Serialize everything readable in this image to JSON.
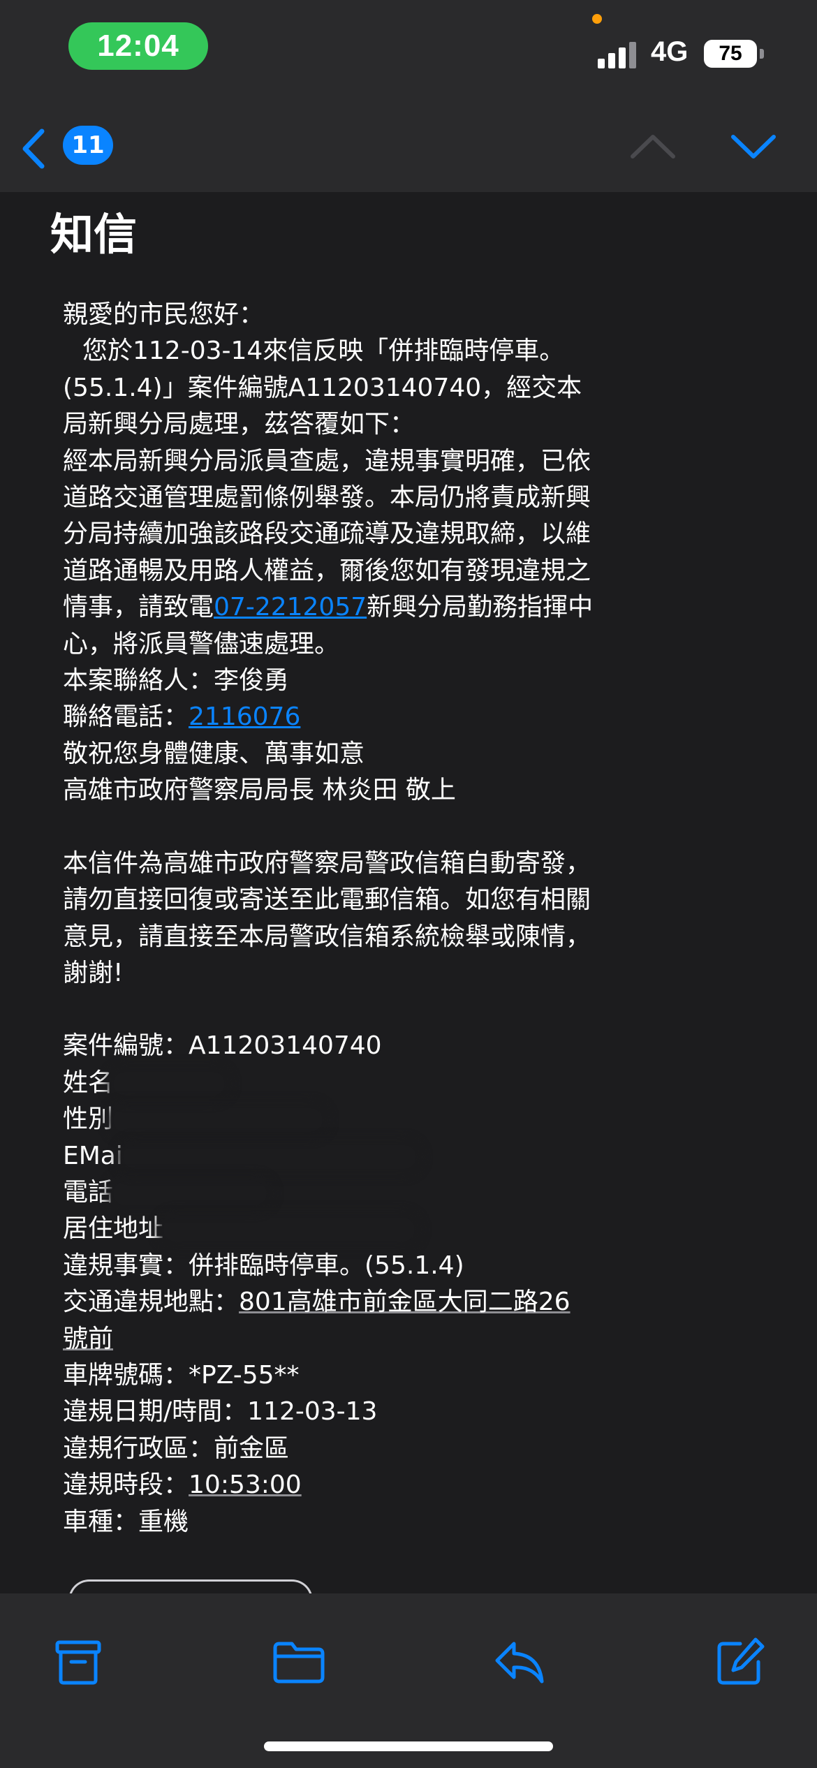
{
  "status_bar": {
    "time": "12:04",
    "network": "4G",
    "battery": "75",
    "colors": {
      "time_pill": "#34c759",
      "privacy_dot": "#ff9f0a"
    }
  },
  "nav": {
    "unread_count": "11",
    "back_icon": "chevron-left-icon",
    "prev_icon": "chevron-up-icon",
    "next_icon": "chevron-down-icon"
  },
  "email": {
    "subject": "知信",
    "greeting": "親愛的市民您好：",
    "p1_text": "您於112-03-14來信反映「併排臨時停車。(55.1.4)」案件編號A11203140740，經交本局新興分局處理，茲答覆如下：",
    "p2_text": "經本局新興分局派員查處，違規事實明確，已依道路交通管理處罰條例舉發。本局仍將責成新興分局持續加強該路段交通疏導及違規取締，以維道路通暢及用路人權益，爾後您如有發現違規之情事，請致電",
    "p2_phone": "07-2212057",
    "p2_suffix": "新興分局勤務指揮中心，將派員警儘速處理。",
    "contact_label": "本案聯絡人：",
    "contact_name": "李俊勇",
    "phone_label": "聯絡電話：",
    "phone_value": "2116076",
    "closing": "敬祝您身體健康、萬事如意",
    "signature": "高雄市政府警察局局長 林炎田 敬上",
    "notice": "本信件為高雄市政府警察局警政信箱自動寄發，請勿直接回復或寄送至此電郵信箱。如您有相關意見，請直接至本局警政信箱系統檢舉或陳情，謝謝!",
    "case_label": "案件編號：",
    "case_value": "A11203140740",
    "name_label": "姓名",
    "gender_label": "性別",
    "email_label": "EMai",
    "tel_label": "電話",
    "address_label": "居住地址",
    "violation_label": "違規事實：",
    "violation_value": "併排臨時停車。(55.1.4)",
    "location_label": "交通違規地點：",
    "location_value": "801高雄市前金區大同二路26號前",
    "plate_label": "車牌號碼：",
    "plate_value": "*PZ-55**",
    "date_label": "違規日期/時間：",
    "date_value": "112-03-13",
    "district_label": "違規行政區：",
    "district_value": "前金區",
    "time_label": "違規時段：",
    "time_value": "10:53:00",
    "vehicle_label": "車種：",
    "vehicle_value": "重機"
  },
  "toolbar": {
    "icons": [
      "archive-icon",
      "folder-icon",
      "reply-icon",
      "compose-icon"
    ],
    "accent": "#0a84ff"
  }
}
